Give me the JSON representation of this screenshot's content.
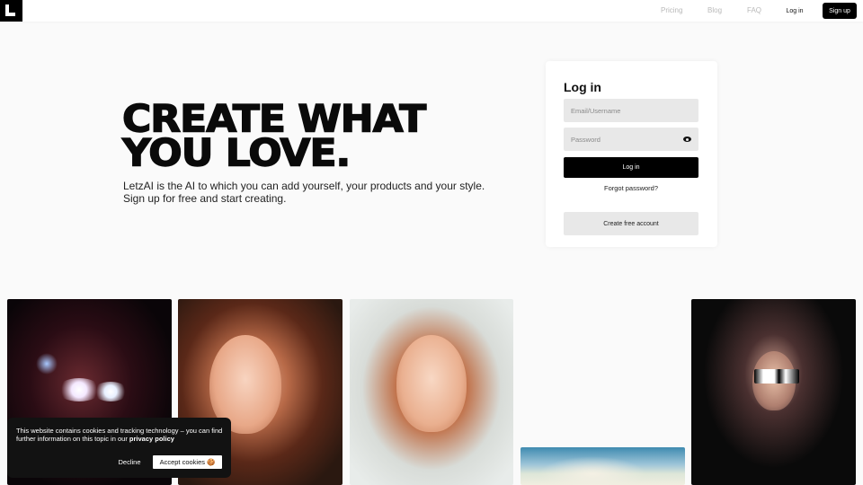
{
  "header": {
    "nav": [
      "Pricing",
      "Blog",
      "FAQ"
    ],
    "login_label": "Log in",
    "signup_label": "Sign up"
  },
  "hero": {
    "title_line1": "CREATE WHAT",
    "title_line2": "YOU LOVE.",
    "subtitle_line1": "LetzAI is the AI to which you can add yourself, your products and your style.",
    "subtitle_line2": "Sign up for free and start creating."
  },
  "login_card": {
    "title": "Log in",
    "email_placeholder": "Email/Username",
    "password_placeholder": "Password",
    "login_button": "Log in",
    "forgot_link": "Forgot password?",
    "create_button": "Create free account",
    "eye_icon": "eye-icon"
  },
  "cookie_banner": {
    "text": "This website contains cookies and tracking technology – you can find further information on this topic in our",
    "policy_link": "privacy policy",
    "decline_label": "Decline",
    "accept_label": "Accept cookies 🍪"
  },
  "colors": {
    "primary": "#000000",
    "background": "#fafafa",
    "field": "#e8e8e8",
    "nav_muted": "#b9b9b9"
  }
}
